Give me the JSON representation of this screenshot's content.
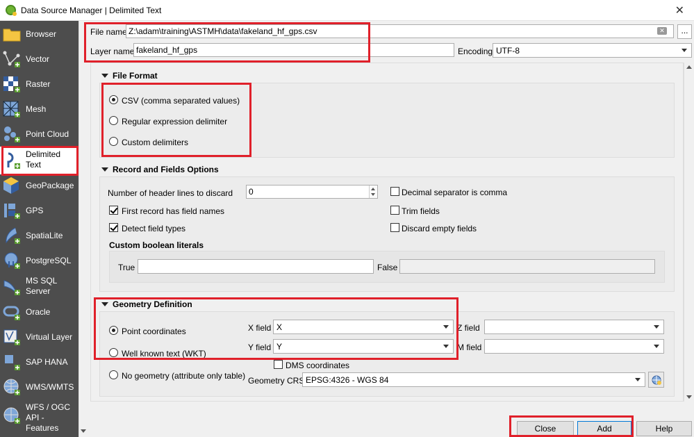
{
  "window": {
    "title": "Data Source Manager | Delimited Text",
    "close_glyph": "✕"
  },
  "sidebar": {
    "items": [
      {
        "label": "Browser",
        "icon": "folder-icon"
      },
      {
        "label": "Vector",
        "icon": "vector-icon"
      },
      {
        "label": "Raster",
        "icon": "raster-icon"
      },
      {
        "label": "Mesh",
        "icon": "mesh-icon"
      },
      {
        "label": "Point Cloud",
        "icon": "point-cloud-icon"
      },
      {
        "label": "Delimited Text",
        "icon": "delimited-text-icon",
        "selected": true
      },
      {
        "label": "GeoPackage",
        "icon": "geopackage-icon"
      },
      {
        "label": "GPS",
        "icon": "gps-icon"
      },
      {
        "label": "SpatiaLite",
        "icon": "spatialite-icon"
      },
      {
        "label": "PostgreSQL",
        "icon": "postgresql-icon"
      },
      {
        "label": "MS SQL Server",
        "icon": "mssql-icon"
      },
      {
        "label": "Oracle",
        "icon": "oracle-icon"
      },
      {
        "label": "Virtual Layer",
        "icon": "virtual-layer-icon"
      },
      {
        "label": "SAP HANA",
        "icon": "sap-hana-icon"
      },
      {
        "label": "WMS/WMTS",
        "icon": "wms-icon"
      },
      {
        "label": "WFS / OGC API - Features",
        "icon": "wfs-icon"
      }
    ]
  },
  "file": {
    "name_label": "File name",
    "name_value": "Z:\\adam\\training\\ASTMH\\data\\fakeland_hf_gps.csv",
    "browse_label": "...",
    "layer_label": "Layer name",
    "layer_value": "fakeland_hf_gps",
    "encoding_label": "Encoding",
    "encoding_value": "UTF-8"
  },
  "file_format": {
    "title": "File Format",
    "options": [
      {
        "label": "CSV (comma separated values)",
        "checked": true
      },
      {
        "label": "Regular expression delimiter",
        "checked": false
      },
      {
        "label": "Custom delimiters",
        "checked": false
      }
    ]
  },
  "record": {
    "title": "Record and Fields Options",
    "header_lines_label": "Number of header lines to discard",
    "header_lines_value": "0",
    "first_record": "First record has field names",
    "detect_types": "Detect field types",
    "decimal_comma": "Decimal separator is comma",
    "trim_fields": "Trim fields",
    "discard_empty": "Discard empty fields",
    "boolean_title": "Custom boolean literals",
    "true_label": "True",
    "true_value": "",
    "false_label": "False",
    "false_value": ""
  },
  "geometry": {
    "title": "Geometry Definition",
    "point_coords": "Point coordinates",
    "wkt": "Well known text (WKT)",
    "no_geom": "No geometry (attribute only table)",
    "x_label": "X field",
    "x_value": "X",
    "y_label": "Y field",
    "y_value": "Y",
    "z_label": "Z field",
    "z_value": "",
    "m_label": "M field",
    "m_value": "",
    "dms": "DMS coordinates",
    "crs_label": "Geometry CRS",
    "crs_value": "EPSG:4326 - WGS 84"
  },
  "buttons": {
    "close": "Close",
    "add": "Add",
    "help": "Help"
  },
  "colors": {
    "highlight": "#e0202a",
    "sidebar_bg": "#4d4d4d"
  }
}
